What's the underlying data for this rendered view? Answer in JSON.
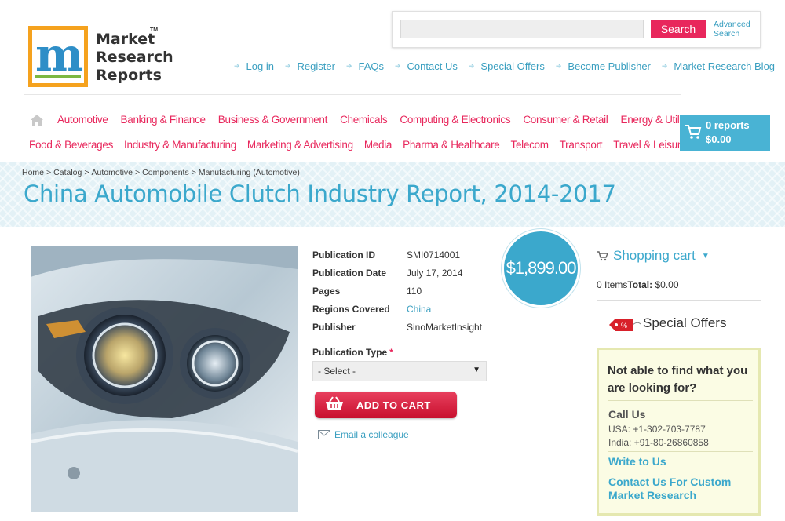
{
  "brand": {
    "name_line1": "Market",
    "name_line2": "Research",
    "name_line3": "Reports",
    "tm": "TM"
  },
  "search": {
    "placeholder": "",
    "button_label": "Search",
    "advanced_label": "Advanced Search"
  },
  "top_links": [
    "Log in",
    "Register",
    "FAQs",
    "Contact Us",
    "Special Offers",
    "Become Publisher",
    "Market Research Blog"
  ],
  "categories_row1": [
    "Automotive",
    "Banking & Finance",
    "Business & Government",
    "Chemicals",
    "Computing & Electronics",
    "Consumer & Retail",
    "Energy & Utilities"
  ],
  "categories_row2": [
    "Food & Beverages",
    "Industry & Manufacturing",
    "Marketing & Advertising",
    "Media",
    "Pharma & Healthcare",
    "Telecom",
    "Transport",
    "Travel & Leisure"
  ],
  "cart": {
    "count_label": "0 reports",
    "total_label": "$0.00"
  },
  "breadcrumb": [
    "Home",
    "Catalog",
    "Automotive",
    "Components",
    "Manufacturing (Automotive)"
  ],
  "page_title": "China Automobile Clutch Industry Report, 2014-2017",
  "details": [
    {
      "label": "Publication ID",
      "value": "SMI0714001",
      "link": false
    },
    {
      "label": "Publication Date",
      "value": "July 17, 2014",
      "link": false
    },
    {
      "label": "Pages",
      "value": "110",
      "link": false
    },
    {
      "label": "Regions Covered",
      "value": "China",
      "link": true
    },
    {
      "label": "Publisher",
      "value": "SinoMarketInsight",
      "link": false
    }
  ],
  "price": "$1,899.00",
  "publication_type": {
    "label": "Publication Type",
    "required_mark": "*",
    "selected": "- Select -"
  },
  "add_to_cart_label": "ADD TO CART",
  "email_colleague_label": "Email a colleague",
  "sidebar": {
    "cart_title": "Shopping cart",
    "items_label": "0 Items",
    "total_label": "Total:",
    "total_value": "$0.00",
    "special_offers": "Special Offers",
    "help_question": "Not able to find what you are looking for?",
    "call_us": "Call Us",
    "phone_usa": "USA: +1-302-703-7787",
    "phone_india": "India: +91-80-26860858",
    "write_to_us": "Write to Us",
    "custom_research": "Contact Us For Custom Market Research"
  },
  "colors": {
    "accent_pink": "#e8275c",
    "accent_blue": "#3ba8cc",
    "logo_orange": "#f5a21e"
  }
}
